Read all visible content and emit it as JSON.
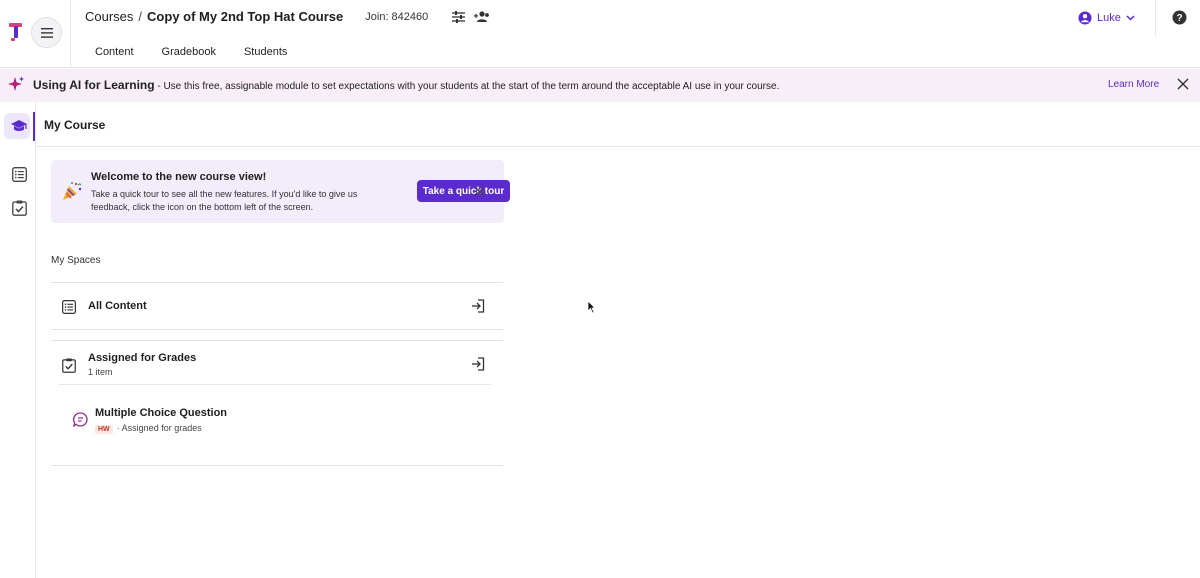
{
  "header": {
    "breadcrumb": {
      "courses": "Courses",
      "separator": "/",
      "course_name": "Copy of My 2nd Top Hat Course"
    },
    "join_code": "Join: 842460",
    "tabs": [
      "Content",
      "Gradebook",
      "Students"
    ],
    "user_name": "Luke"
  },
  "banner": {
    "title": "Using AI for Learning",
    "text": " - Use this free, assignable module to set expectations with your students at the start of the term around the acceptable AI use in your course.",
    "link": "Learn More"
  },
  "page": {
    "title": "My Course"
  },
  "welcome": {
    "title": "Welcome to the new course view!",
    "body": "Take a quick tour to see all the new features. If you'd like to give us feedback, click the icon on the bottom left of the screen.",
    "button": "Take a quick tour"
  },
  "spaces": {
    "title": "My Spaces",
    "all_content": "All Content",
    "assigned": {
      "title": "Assigned for Grades",
      "count": "1 item",
      "item": {
        "title": "Multiple Choice Question",
        "badge": "HW",
        "status": "· Assigned for grades"
      }
    }
  },
  "colors": {
    "accent": "#5b2bd0",
    "banner_bg": "#f7eef8",
    "welcome_bg": "#f2ecfb"
  },
  "icons": [
    "tophat-logo-icon",
    "hamburger-menu-icon",
    "sliders-icon",
    "add-people-icon",
    "user-circle-icon",
    "chevron-down-icon",
    "help-icon",
    "sparkle-icon",
    "close-icon",
    "graduation-cap-icon",
    "list-icon",
    "clipboard-check-icon",
    "party-popper-icon",
    "enter-icon",
    "question-chat-icon"
  ]
}
